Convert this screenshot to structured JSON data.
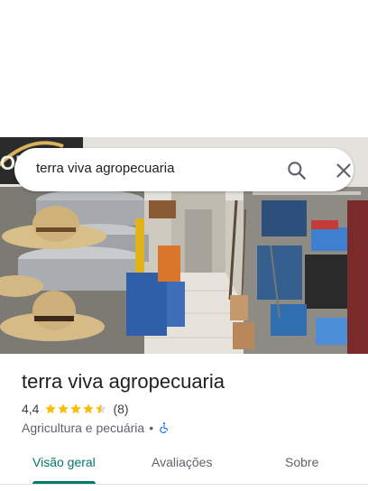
{
  "search": {
    "query": "terra viva agropecuaria"
  },
  "place": {
    "name": "terra viva agropecuaria",
    "rating": "4,4",
    "stars": 4.4,
    "review_count": "(8)",
    "category": "Agricultura e pecuária",
    "separator": "•",
    "accessibility_icon": "wheelchair-icon"
  },
  "photo": {
    "partial_sign_text": "OR"
  },
  "tabs": [
    {
      "label": "Visão geral",
      "active": true
    },
    {
      "label": "Avaliações",
      "active": false
    },
    {
      "label": "Sobre",
      "active": false
    }
  ],
  "colors": {
    "accent": "#00796b",
    "star": "#fbbc04",
    "accessibility": "#1a73e8"
  }
}
